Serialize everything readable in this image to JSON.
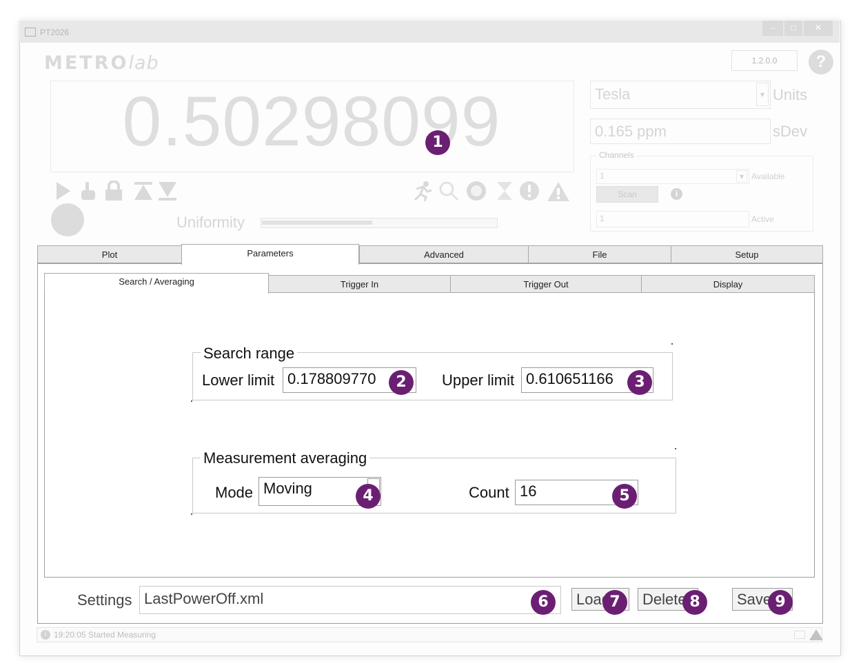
{
  "window": {
    "title": "PT2026",
    "logo": "METRO",
    "logo_italic": "lab",
    "version": "1.2.0.0",
    "help": "?"
  },
  "reading": {
    "value": "0.50298099",
    "uniformity_label": "Uniformity",
    "uniformity_fraction": 0.47
  },
  "units": {
    "selected": "Tesla",
    "label": "Units"
  },
  "sdev": {
    "value": "0.165 ppm",
    "label": "sDev"
  },
  "channels": {
    "legend": "Channels",
    "available_value": "1",
    "available_label": "Available",
    "scan_label": "Scan",
    "active_value": "1",
    "active_label": "Active"
  },
  "tabs": [
    {
      "label": "Plot"
    },
    {
      "label": "Parameters"
    },
    {
      "label": "Advanced"
    },
    {
      "label": "File"
    },
    {
      "label": "Setup"
    }
  ],
  "subtabs": [
    {
      "label": "Search / Averaging"
    },
    {
      "label": "Trigger In"
    },
    {
      "label": "Trigger Out"
    },
    {
      "label": "Display"
    }
  ],
  "search_range": {
    "legend": "Search range",
    "lower_label": "Lower limit",
    "lower_value": "0.178809770",
    "upper_label": "Upper limit",
    "upper_value": "0.610651166"
  },
  "averaging": {
    "legend": "Measurement averaging",
    "mode_label": "Mode",
    "mode_value": "Moving",
    "count_label": "Count",
    "count_value": "16"
  },
  "settings": {
    "label": "Settings",
    "value": "LastPowerOff.xml",
    "load_label": "Load",
    "delete_label": "Delete",
    "save_label": "Save"
  },
  "badges": [
    "1",
    "2",
    "3",
    "4",
    "5",
    "6",
    "7",
    "8",
    "9"
  ],
  "status": {
    "text": "19:20:05 Started Measuring",
    "info": "i"
  },
  "colors": {
    "badge": "#6b1f72",
    "disabled_text": "#d5d5d5",
    "tab_border": "#a8a8a8"
  }
}
